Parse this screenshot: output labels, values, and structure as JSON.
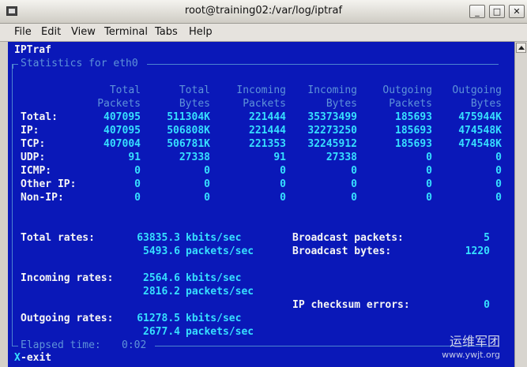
{
  "window": {
    "title": "root@training02:/var/log/iptraf",
    "minimize_label": "_",
    "maximize_label": "□",
    "close_label": "✕"
  },
  "menu": [
    "File",
    "Edit",
    "View",
    "Terminal",
    "Tabs",
    "Help"
  ],
  "terminal": {
    "app_name": "IPTraf",
    "section_title": "Statistics for eth0",
    "column_headers": [
      [
        "Total",
        "Packets"
      ],
      [
        "Total",
        "Bytes"
      ],
      [
        "Incoming",
        "Packets"
      ],
      [
        "Incoming",
        "Bytes"
      ],
      [
        "Outgoing",
        "Packets"
      ],
      [
        "Outgoing",
        "Bytes"
      ]
    ],
    "rows": [
      {
        "label": "Total:",
        "values": [
          "407095",
          "511304K",
          "221444",
          "35373499",
          "185693",
          "475944K"
        ]
      },
      {
        "label": "IP:",
        "values": [
          "407095",
          "506808K",
          "221444",
          "32273250",
          "185693",
          "474548K"
        ]
      },
      {
        "label": "TCP:",
        "values": [
          "407004",
          "506781K",
          "221353",
          "32245912",
          "185693",
          "474548K"
        ]
      },
      {
        "label": "UDP:",
        "values": [
          "91",
          "27338",
          "91",
          "27338",
          "0",
          "0"
        ]
      },
      {
        "label": "ICMP:",
        "values": [
          "0",
          "0",
          "0",
          "0",
          "0",
          "0"
        ]
      },
      {
        "label": "Other IP:",
        "values": [
          "0",
          "0",
          "0",
          "0",
          "0",
          "0"
        ]
      },
      {
        "label": "Non-IP:",
        "values": [
          "0",
          "0",
          "0",
          "0",
          "0",
          "0"
        ]
      }
    ],
    "total_rates": {
      "label": "Total rates:",
      "kbits": "63835.3",
      "kbits_unit": "kbits/sec",
      "packets": "5493.6",
      "packets_unit": "packets/sec"
    },
    "incoming_rates": {
      "label": "Incoming rates:",
      "kbits": "2564.6",
      "kbits_unit": "kbits/sec",
      "packets": "2816.2",
      "packets_unit": "packets/sec"
    },
    "outgoing_rates": {
      "label": "Outgoing rates:",
      "kbits": "61278.5",
      "kbits_unit": "kbits/sec",
      "packets": "2677.4",
      "packets_unit": "packets/sec"
    },
    "broadcast_packets": {
      "label": "Broadcast packets:",
      "value": "5"
    },
    "broadcast_bytes": {
      "label": "Broadcast bytes:",
      "value": "1220"
    },
    "checksum_errors": {
      "label": "IP checksum errors:",
      "value": "0"
    },
    "elapsed": {
      "label": "Elapsed time:",
      "value": "0:02"
    },
    "exit_key": "X",
    "exit_text": "-exit"
  },
  "watermark": {
    "cn": "运维军团",
    "site": "www.ywjt.org"
  },
  "colors": {
    "terminal_bg": "#0a18b8",
    "value_cyan": "#36dfff",
    "label_white": "#f5f5f5",
    "border_blue": "#5e93d8"
  }
}
